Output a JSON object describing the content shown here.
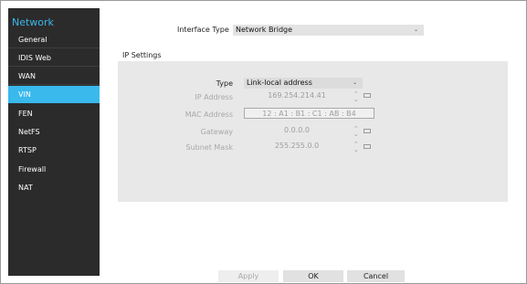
{
  "sidebar": {
    "title": "Network",
    "items": [
      {
        "label": "General"
      },
      {
        "label": "IDIS Web"
      },
      {
        "label": "WAN"
      },
      {
        "label": "VIN"
      },
      {
        "label": "FEN"
      },
      {
        "label": "NetFS"
      },
      {
        "label": "RTSP"
      },
      {
        "label": "Firewall"
      },
      {
        "label": "NAT"
      }
    ],
    "active_item": "VIN"
  },
  "interface": {
    "label": "Interface Type",
    "value": "Network Bridge"
  },
  "ip_settings": {
    "heading": "IP Settings",
    "type_label": "Type",
    "type_value": "Link-local address",
    "ip_label": "IP Address",
    "ip_value": "169.254.214.41",
    "mac_label": "MAC Address",
    "mac_value": "12 : A1 : B1 : C1 : AB : B4",
    "gateway_label": "Gateway",
    "gateway_value": "0.0.0.0",
    "subnet_label": "Subnet Mask",
    "subnet_value": "255.255.0.0"
  },
  "buttons": {
    "apply": "Apply",
    "ok": "OK",
    "cancel": "Cancel"
  },
  "colors": {
    "accent": "#39b9ec",
    "sidebar_bg": "#2b2b2b",
    "panel_bg": "#e8e8e8"
  },
  "icons": [
    "spinner-arrows-icon",
    "keyboard-icon",
    "dropdown-caret-icon"
  ]
}
